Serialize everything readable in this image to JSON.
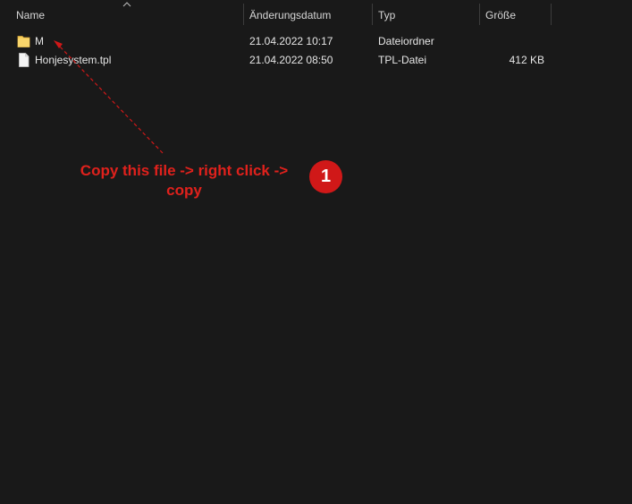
{
  "columns": {
    "name": "Name",
    "modified": "Änderungsdatum",
    "type": "Typ",
    "size": "Größe"
  },
  "files": [
    {
      "icon": "folder-icon",
      "name": "M",
      "modified": "21.04.2022 10:17",
      "type": "Dateiordner",
      "size": ""
    },
    {
      "icon": "file-icon",
      "name": "Honjesystem.tpl",
      "modified": "21.04.2022 08:50",
      "type": "TPL-Datei",
      "size": "412 KB"
    }
  ],
  "annotation": {
    "text": "Copy this file -> right click -> copy",
    "step": "1",
    "color": "#e0211c"
  },
  "colors": {
    "background": "#191919",
    "text": "#e6e6e6",
    "folder": "#f5cc5a",
    "annotation_red": "#d01818"
  }
}
